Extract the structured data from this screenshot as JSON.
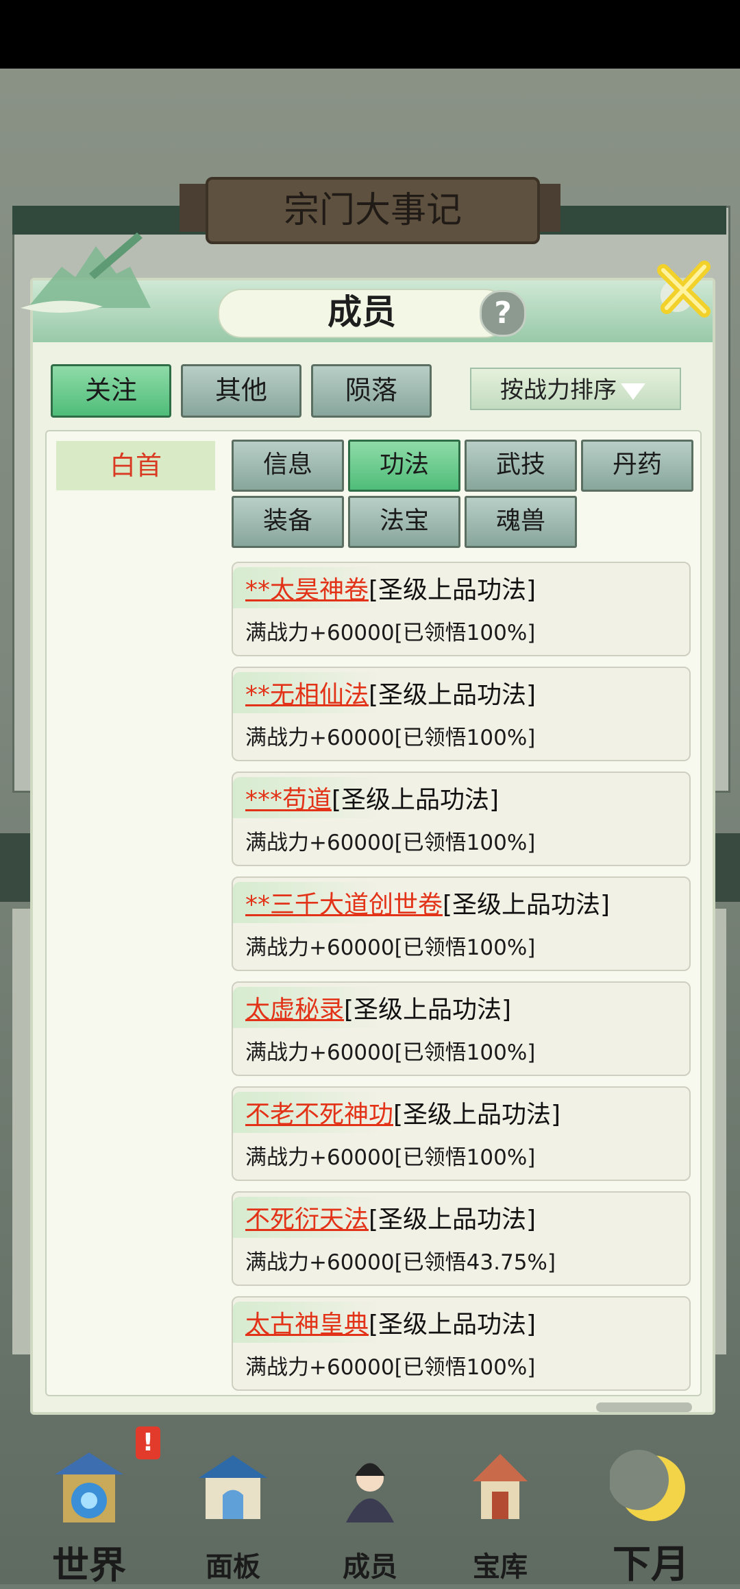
{
  "background": {
    "banner_title": "宗门大事记"
  },
  "modal": {
    "title": "成员",
    "help_glyph": "?",
    "filters": [
      "关注",
      "其他",
      "陨落"
    ],
    "active_filter": "关注",
    "sort_label": "按战力排序",
    "members": [
      "白首"
    ],
    "tabs": [
      "信息",
      "功法",
      "武技",
      "丹药",
      "装备",
      "法宝",
      "魂兽"
    ],
    "active_tab": "功法",
    "skills": [
      {
        "name": "**太昊神卷",
        "grade": "[圣级上品功法]",
        "desc": "满战力+60000[已领悟100%]"
      },
      {
        "name": "**无相仙法",
        "grade": "[圣级上品功法]",
        "desc": "满战力+60000[已领悟100%]"
      },
      {
        "name": "***苟道",
        "grade": "[圣级上品功法]",
        "desc": "满战力+60000[已领悟100%]"
      },
      {
        "name": "**三千大道创世卷",
        "grade": "[圣级上品功法]",
        "desc": "满战力+60000[已领悟100%]"
      },
      {
        "name": "太虚秘录",
        "grade": "[圣级上品功法]",
        "desc": "满战力+60000[已领悟100%]"
      },
      {
        "name": "不老不死神功",
        "grade": "[圣级上品功法]",
        "desc": "满战力+60000[已领悟100%]"
      },
      {
        "name": "不死衍天法",
        "grade": "[圣级上品功法]",
        "desc": "满战力+60000[已领悟43.75%]"
      },
      {
        "name": "太古神皇典",
        "grade": "[圣级上品功法]",
        "desc": "满战力+60000[已领悟100%]"
      }
    ]
  },
  "bottom_nav": [
    {
      "label": "世界",
      "icon": "world-pagoda-icon",
      "badge": "!"
    },
    {
      "label": "面板",
      "icon": "panel-gate-icon"
    },
    {
      "label": "成员",
      "icon": "member-portrait-icon"
    },
    {
      "label": "宝库",
      "icon": "treasury-tower-icon"
    },
    {
      "label": "下月",
      "icon": "crescent-moon-icon"
    }
  ],
  "colors": {
    "accent_red": "#e23218",
    "active_green": "#4fbd79",
    "inactive_tab": "#9fb7ae"
  }
}
